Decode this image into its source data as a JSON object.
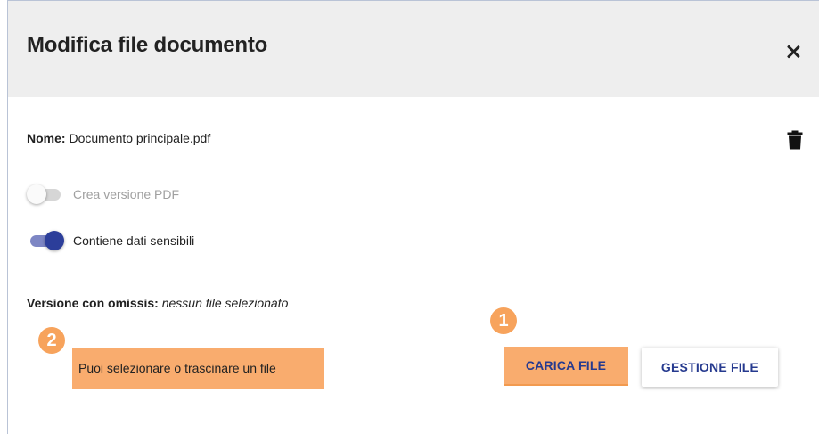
{
  "dialog": {
    "title": "Modifica file documento"
  },
  "file": {
    "name_label": "Nome:",
    "name_value": "Documento principale.pdf"
  },
  "toggles": [
    {
      "label": "Crea versione PDF",
      "checked": false,
      "disabled": true
    },
    {
      "label": "Contiene dati sensibili",
      "checked": true,
      "disabled": false
    }
  ],
  "omissis": {
    "label": "Versione con omissis:",
    "value": "nessun file selezionato"
  },
  "dropzone": {
    "text": "Puoi selezionare o trascinare un file"
  },
  "buttons": {
    "upload": "CARICA FILE",
    "manage": "GESTIONE FILE"
  },
  "badges": {
    "first": "1",
    "second": "2"
  },
  "colors": {
    "highlight": "#f9ac6e",
    "badge": "#f7a35c",
    "accent": "#263a8f"
  },
  "icons": {
    "close": "close-icon",
    "trash": "trash-icon"
  }
}
